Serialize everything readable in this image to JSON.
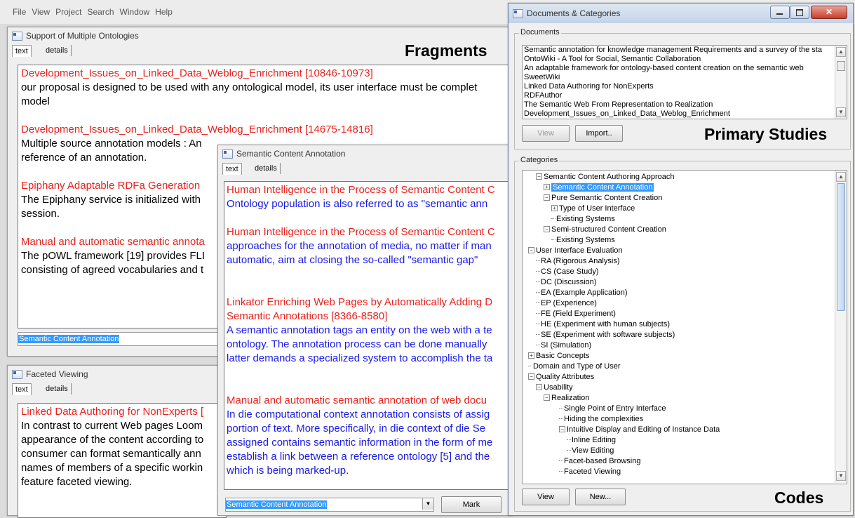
{
  "menu": [
    "File",
    "View",
    "Project",
    "Search",
    "Window",
    "Help"
  ],
  "win_ontologies": {
    "title": "Support of Multiple Ontologies",
    "tab_text": "text",
    "tab_details": "details",
    "label": "Fragments",
    "lines": [
      {
        "cls": "red",
        "text": "Development_Issues_on_Linked_Data_Weblog_Enrichment [10846-10973]"
      },
      {
        "cls": "blk",
        "text": "our proposal is designed to be used with any ontological model, its user interface must be complet"
      },
      {
        "cls": "blk",
        "text": "model"
      },
      {
        "cls": "gap",
        "text": ""
      },
      {
        "cls": "red",
        "text": "Development_Issues_on_Linked_Data_Weblog_Enrichment [14675-14816]"
      },
      {
        "cls": "blk",
        "text": "Multiple source annotation models : An"
      },
      {
        "cls": "blk",
        "text": "reference of an annotation."
      },
      {
        "cls": "gap",
        "text": ""
      },
      {
        "cls": "red",
        "text": "Epiphany Adaptable RDFa Generation"
      },
      {
        "cls": "blk",
        "text": "The Epiphany service is initialized with"
      },
      {
        "cls": "blk",
        "text": "session."
      },
      {
        "cls": "gap",
        "text": ""
      },
      {
        "cls": "red",
        "text": "Manual and automatic semantic annota"
      },
      {
        "cls": "blk",
        "text": "The pOWL framework [19] provides FLI"
      },
      {
        "cls": "blk",
        "text": "consisting of agreed vocabularies and t"
      }
    ],
    "input_value": "Semantic Content Annotation"
  },
  "win_faceted": {
    "title": "Faceted Viewing",
    "tab_text": "text",
    "tab_details": "details",
    "lines": [
      {
        "cls": "red",
        "text": "Linked Data Authoring for NonExperts ["
      },
      {
        "cls": "blk",
        "text": "In contrast to current Web pages Loom"
      },
      {
        "cls": "blk",
        "text": "appearance of the content according to"
      },
      {
        "cls": "blk",
        "text": "consumer can format semantically ann"
      },
      {
        "cls": "blk",
        "text": "names of members of a specific workin"
      },
      {
        "cls": "blk",
        "text": "feature faceted viewing."
      }
    ]
  },
  "win_sca": {
    "title": "Semantic Content Annotation",
    "tab_text": "text",
    "tab_details": "details",
    "lines": [
      {
        "cls": "red",
        "text": "Human Intelligence in the Process of Semantic Content C"
      },
      {
        "cls": "blue",
        "text": "Ontology population is also referred to as \"semantic ann"
      },
      {
        "cls": "gap",
        "text": ""
      },
      {
        "cls": "red",
        "text": "Human Intelligence in the Process of Semantic Content C"
      },
      {
        "cls": "blue",
        "text": "approaches for the annotation of media, no matter if man"
      },
      {
        "cls": "blue",
        "text": "automatic, aim at closing the so-called \"semantic gap\""
      },
      {
        "cls": "gap",
        "text": ""
      },
      {
        "cls": "gap",
        "text": ""
      },
      {
        "cls": "red",
        "text": "Linkator Enriching Web Pages by Automatically Adding D"
      },
      {
        "cls": "red",
        "text": "Semantic Annotations [8366-8580]"
      },
      {
        "cls": "blue",
        "text": "A semantic annotation tags an entity on the web with a te"
      },
      {
        "cls": "blue",
        "text": "ontology. The annotation process can be done manually"
      },
      {
        "cls": "blue",
        "text": "latter demands a specialized system to accomplish the ta"
      },
      {
        "cls": "gap",
        "text": ""
      },
      {
        "cls": "gap",
        "text": ""
      },
      {
        "cls": "red",
        "text": "Manual and automatic semantic annotation of web docu"
      },
      {
        "cls": "blue",
        "text": "In die computational context annotation consists of assig"
      },
      {
        "cls": "blue",
        "text": "portion of text. More specifically, in die context of die Se"
      },
      {
        "cls": "blue",
        "text": "assigned contains semantic information in the form of me"
      },
      {
        "cls": "blue",
        "text": "establish a link between a reference ontology [5] and the"
      },
      {
        "cls": "blue",
        "text": "which is being marked-up."
      }
    ],
    "combo_value": "Semantic Content Annotation",
    "mark_label": "Mark"
  },
  "win_docs": {
    "title": "Documents & Categories",
    "documents_legend": "Documents",
    "documents": [
      "Semantic annotation for knowledge management Requirements and a survey of the sta",
      "OntoWiki - A Tool for Social, Semantic Collaboration",
      "An adaptable framework for ontology-based content creation on the semantic web",
      "SweetWiki",
      "Linked Data Authoring for NonExperts",
      "RDFAuthor",
      "The Semantic Web From Representation to Realization",
      "Development_Issues_on_Linked_Data_Weblog_Enrichment"
    ],
    "view_label": "View",
    "import_label": "Import..",
    "primary_label": "Primary Studies",
    "categories_legend": "Categories",
    "tree": [
      {
        "depth": 1,
        "exp": "⊟",
        "text": "Semantic Content Authoring Approach"
      },
      {
        "depth": 2,
        "exp": "⊞",
        "text": "Semantic Content Annotation",
        "sel": true
      },
      {
        "depth": 2,
        "exp": "⊟",
        "text": "Pure Semantic Content Creation"
      },
      {
        "depth": 3,
        "exp": "⊞",
        "text": "Type of User Interface"
      },
      {
        "depth": 3,
        "exp": "",
        "text": "Existing Systems"
      },
      {
        "depth": 2,
        "exp": "⊟",
        "text": "Semi-structured Content Creation"
      },
      {
        "depth": 3,
        "exp": "",
        "text": "Existing Systems"
      },
      {
        "depth": 0,
        "exp": "⊟",
        "text": "User Interface Evaluation"
      },
      {
        "depth": 1,
        "exp": "",
        "text": "RA (Rigorous Analysis)"
      },
      {
        "depth": 1,
        "exp": "",
        "text": "CS (Case Study)"
      },
      {
        "depth": 1,
        "exp": "",
        "text": "DC (Discussion)"
      },
      {
        "depth": 1,
        "exp": "",
        "text": "EA (Example Application)"
      },
      {
        "depth": 1,
        "exp": "",
        "text": "EP (Experience)"
      },
      {
        "depth": 1,
        "exp": "",
        "text": "FE (Field Experiment)"
      },
      {
        "depth": 1,
        "exp": "",
        "text": "HE (Experiment with human subjects)"
      },
      {
        "depth": 1,
        "exp": "",
        "text": "SE (Experiment with software subjects)"
      },
      {
        "depth": 1,
        "exp": "",
        "text": "SI (Simulation)"
      },
      {
        "depth": 0,
        "exp": "⊞",
        "text": "Basic Concepts"
      },
      {
        "depth": 0,
        "exp": "",
        "text": "Domain and Type of User"
      },
      {
        "depth": 0,
        "exp": "⊟",
        "text": "Quality Attributes"
      },
      {
        "depth": 1,
        "exp": "⊟",
        "text": "Usability"
      },
      {
        "depth": 2,
        "exp": "⊟",
        "text": "Realization"
      },
      {
        "depth": 4,
        "exp": "",
        "text": "Single Point of Entry Interface"
      },
      {
        "depth": 4,
        "exp": "",
        "text": "Hiding the complexities"
      },
      {
        "depth": 4,
        "exp": "⊟",
        "text": "Intuitive Display and Editing of Instance Data"
      },
      {
        "depth": 5,
        "exp": "",
        "text": "Inline Editing"
      },
      {
        "depth": 5,
        "exp": "",
        "text": "View Editing"
      },
      {
        "depth": 4,
        "exp": "",
        "text": "Facet-based Browsing"
      },
      {
        "depth": 4,
        "exp": "",
        "text": "Faceted Viewing"
      }
    ],
    "view2_label": "View",
    "new_label": "New...",
    "codes_label": "Codes"
  }
}
